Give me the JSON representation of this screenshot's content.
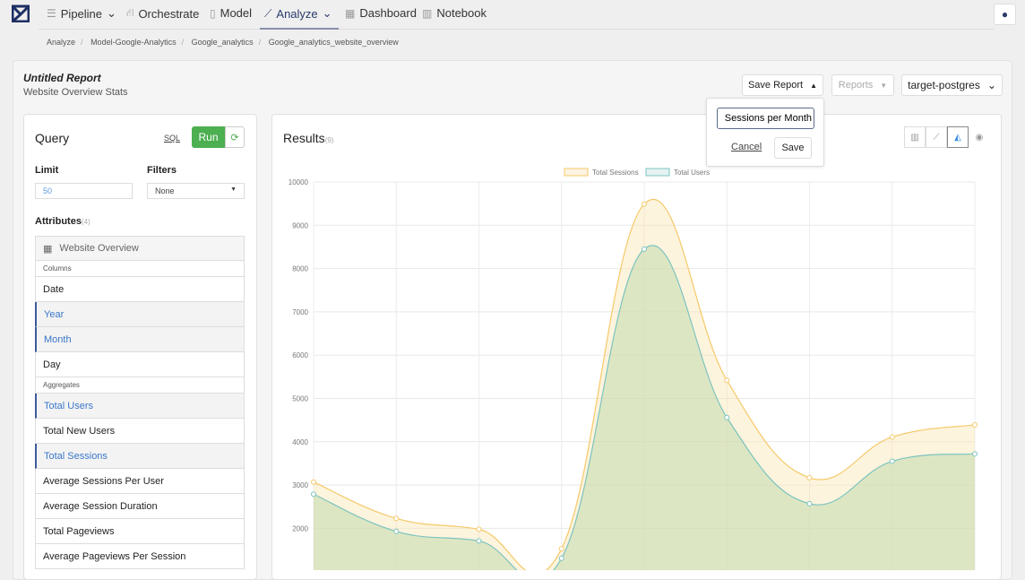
{
  "nav": {
    "items": [
      {
        "label": "Pipeline",
        "icon": "menu-icon"
      },
      {
        "label": "Orchestrate",
        "icon": "flow-icon"
      },
      {
        "label": "Model",
        "icon": "file-icon"
      },
      {
        "label": "Analyze",
        "icon": "chart-icon"
      },
      {
        "label": "Dashboard",
        "icon": "grid-icon"
      },
      {
        "label": "Notebook",
        "icon": "book-icon"
      }
    ]
  },
  "breadcrumbs": [
    "Analyze",
    "Model-Google-Analytics",
    "Google_analytics",
    "Google_analytics_website_overview"
  ],
  "report": {
    "title": "Untitled Report",
    "subtitle": "Website Overview Stats"
  },
  "toolbar": {
    "save_report": "Save Report",
    "reports": "Reports",
    "connection": "target-postgres"
  },
  "save_popover": {
    "input_value": "Sessions per Month",
    "cancel": "Cancel",
    "save": "Save"
  },
  "query": {
    "title": "Query",
    "sql": "SQL",
    "run": "Run",
    "limit_label": "Limit",
    "limit_value": "50",
    "filters_label": "Filters",
    "filters_value": "None",
    "attributes_label": "Attributes",
    "attributes_count": "(4)",
    "table": "Website Overview",
    "columns_label": "Columns",
    "aggregates_label": "Aggregates",
    "columns": [
      {
        "label": "Date",
        "selected": false
      },
      {
        "label": "Year",
        "selected": true
      },
      {
        "label": "Month",
        "selected": true
      },
      {
        "label": "Day",
        "selected": false
      }
    ],
    "aggregates": [
      {
        "label": "Total Users",
        "selected": true
      },
      {
        "label": "Total New Users",
        "selected": false
      },
      {
        "label": "Total Sessions",
        "selected": true
      },
      {
        "label": "Average Sessions Per User",
        "selected": false
      },
      {
        "label": "Average Session Duration",
        "selected": false
      },
      {
        "label": "Total Pageviews",
        "selected": false
      },
      {
        "label": "Average Pageviews Per Session",
        "selected": false
      }
    ]
  },
  "results": {
    "title": "Results",
    "count": "(9)",
    "chart_types": [
      "bar-chart-icon",
      "line-chart-icon",
      "area-chart-icon",
      "pie-chart-icon"
    ],
    "active_chart_type": "area-chart-icon"
  },
  "chart_data": {
    "type": "area",
    "ylim": [
      1000,
      10000
    ],
    "yticks": [
      "10000",
      "9000",
      "8000",
      "7000",
      "6000",
      "5000",
      "4000",
      "3000",
      "2000"
    ],
    "grid": true,
    "legend": "top",
    "series": [
      {
        "name": "Total Sessions",
        "color": "#f5c96a",
        "values": [
          3070,
          2230,
          1980,
          1530,
          9490,
          5420,
          3170,
          4110,
          4390
        ]
      },
      {
        "name": "Total Users",
        "color": "#7cc3c0",
        "values": [
          2790,
          1930,
          1710,
          1310,
          8450,
          4560,
          2570,
          3550,
          3720
        ]
      }
    ]
  }
}
